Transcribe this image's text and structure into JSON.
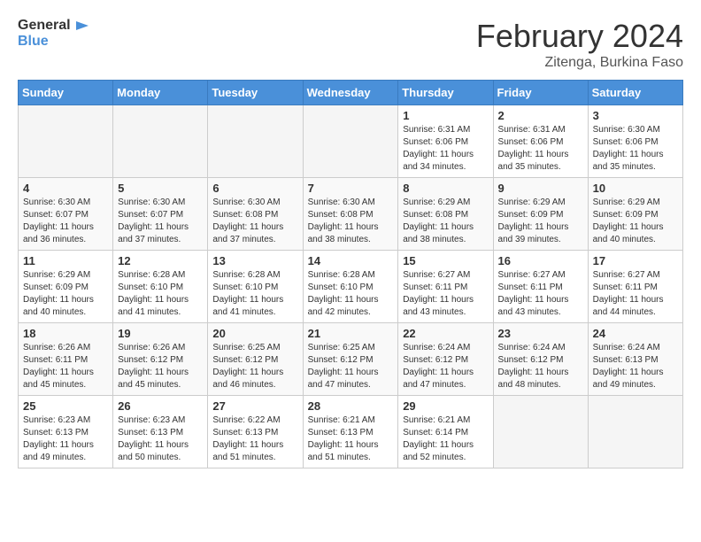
{
  "logo": {
    "line1": "General",
    "line2": "Blue"
  },
  "title": "February 2024",
  "location": "Zitenga, Burkina Faso",
  "days_of_week": [
    "Sunday",
    "Monday",
    "Tuesday",
    "Wednesday",
    "Thursday",
    "Friday",
    "Saturday"
  ],
  "weeks": [
    [
      {
        "day": "",
        "info": ""
      },
      {
        "day": "",
        "info": ""
      },
      {
        "day": "",
        "info": ""
      },
      {
        "day": "",
        "info": ""
      },
      {
        "day": "1",
        "info": "Sunrise: 6:31 AM\nSunset: 6:06 PM\nDaylight: 11 hours and 34 minutes."
      },
      {
        "day": "2",
        "info": "Sunrise: 6:31 AM\nSunset: 6:06 PM\nDaylight: 11 hours and 35 minutes."
      },
      {
        "day": "3",
        "info": "Sunrise: 6:30 AM\nSunset: 6:06 PM\nDaylight: 11 hours and 35 minutes."
      }
    ],
    [
      {
        "day": "4",
        "info": "Sunrise: 6:30 AM\nSunset: 6:07 PM\nDaylight: 11 hours and 36 minutes."
      },
      {
        "day": "5",
        "info": "Sunrise: 6:30 AM\nSunset: 6:07 PM\nDaylight: 11 hours and 37 minutes."
      },
      {
        "day": "6",
        "info": "Sunrise: 6:30 AM\nSunset: 6:08 PM\nDaylight: 11 hours and 37 minutes."
      },
      {
        "day": "7",
        "info": "Sunrise: 6:30 AM\nSunset: 6:08 PM\nDaylight: 11 hours and 38 minutes."
      },
      {
        "day": "8",
        "info": "Sunrise: 6:29 AM\nSunset: 6:08 PM\nDaylight: 11 hours and 38 minutes."
      },
      {
        "day": "9",
        "info": "Sunrise: 6:29 AM\nSunset: 6:09 PM\nDaylight: 11 hours and 39 minutes."
      },
      {
        "day": "10",
        "info": "Sunrise: 6:29 AM\nSunset: 6:09 PM\nDaylight: 11 hours and 40 minutes."
      }
    ],
    [
      {
        "day": "11",
        "info": "Sunrise: 6:29 AM\nSunset: 6:09 PM\nDaylight: 11 hours and 40 minutes."
      },
      {
        "day": "12",
        "info": "Sunrise: 6:28 AM\nSunset: 6:10 PM\nDaylight: 11 hours and 41 minutes."
      },
      {
        "day": "13",
        "info": "Sunrise: 6:28 AM\nSunset: 6:10 PM\nDaylight: 11 hours and 41 minutes."
      },
      {
        "day": "14",
        "info": "Sunrise: 6:28 AM\nSunset: 6:10 PM\nDaylight: 11 hours and 42 minutes."
      },
      {
        "day": "15",
        "info": "Sunrise: 6:27 AM\nSunset: 6:11 PM\nDaylight: 11 hours and 43 minutes."
      },
      {
        "day": "16",
        "info": "Sunrise: 6:27 AM\nSunset: 6:11 PM\nDaylight: 11 hours and 43 minutes."
      },
      {
        "day": "17",
        "info": "Sunrise: 6:27 AM\nSunset: 6:11 PM\nDaylight: 11 hours and 44 minutes."
      }
    ],
    [
      {
        "day": "18",
        "info": "Sunrise: 6:26 AM\nSunset: 6:11 PM\nDaylight: 11 hours and 45 minutes."
      },
      {
        "day": "19",
        "info": "Sunrise: 6:26 AM\nSunset: 6:12 PM\nDaylight: 11 hours and 45 minutes."
      },
      {
        "day": "20",
        "info": "Sunrise: 6:25 AM\nSunset: 6:12 PM\nDaylight: 11 hours and 46 minutes."
      },
      {
        "day": "21",
        "info": "Sunrise: 6:25 AM\nSunset: 6:12 PM\nDaylight: 11 hours and 47 minutes."
      },
      {
        "day": "22",
        "info": "Sunrise: 6:24 AM\nSunset: 6:12 PM\nDaylight: 11 hours and 47 minutes."
      },
      {
        "day": "23",
        "info": "Sunrise: 6:24 AM\nSunset: 6:12 PM\nDaylight: 11 hours and 48 minutes."
      },
      {
        "day": "24",
        "info": "Sunrise: 6:24 AM\nSunset: 6:13 PM\nDaylight: 11 hours and 49 minutes."
      }
    ],
    [
      {
        "day": "25",
        "info": "Sunrise: 6:23 AM\nSunset: 6:13 PM\nDaylight: 11 hours and 49 minutes."
      },
      {
        "day": "26",
        "info": "Sunrise: 6:23 AM\nSunset: 6:13 PM\nDaylight: 11 hours and 50 minutes."
      },
      {
        "day": "27",
        "info": "Sunrise: 6:22 AM\nSunset: 6:13 PM\nDaylight: 11 hours and 51 minutes."
      },
      {
        "day": "28",
        "info": "Sunrise: 6:21 AM\nSunset: 6:13 PM\nDaylight: 11 hours and 51 minutes."
      },
      {
        "day": "29",
        "info": "Sunrise: 6:21 AM\nSunset: 6:14 PM\nDaylight: 11 hours and 52 minutes."
      },
      {
        "day": "",
        "info": ""
      },
      {
        "day": "",
        "info": ""
      }
    ]
  ]
}
